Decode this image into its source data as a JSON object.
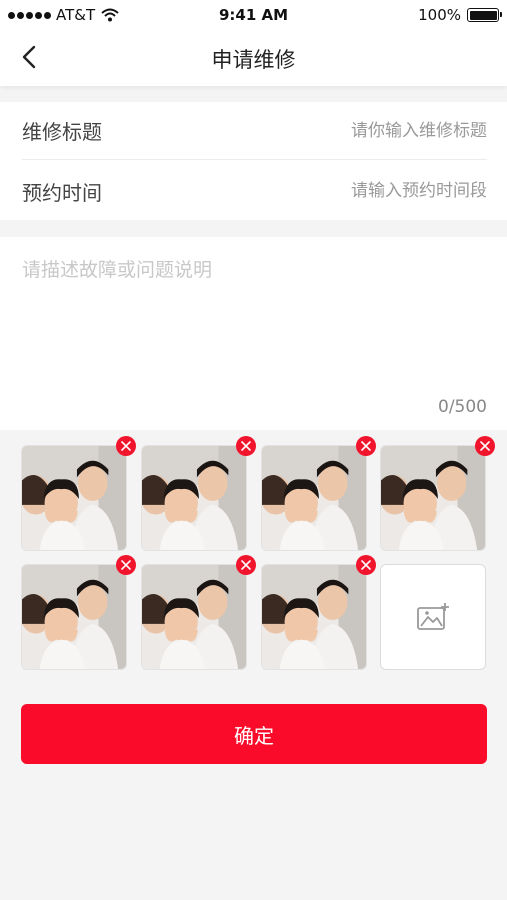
{
  "status_bar": {
    "carrier": "AT&T",
    "time": "9:41 AM",
    "battery": "100%"
  },
  "header": {
    "title": "申请维修"
  },
  "form": {
    "repair_title": {
      "label": "维修标题",
      "placeholder": "请你输入维修标题"
    },
    "appointment_time": {
      "label": "预约时间",
      "placeholder": "请输入预约时间段"
    }
  },
  "description": {
    "placeholder": "请描述故障或问题说明",
    "counter": "0/500"
  },
  "photos": {
    "count": 7,
    "items": [
      "photo-1",
      "photo-2",
      "photo-3",
      "photo-4",
      "photo-5",
      "photo-6",
      "photo-7"
    ]
  },
  "confirm_button": {
    "label": "确定"
  },
  "colors": {
    "accent": "#fb0b2a",
    "remove_badge": "#f0152c",
    "background": "#f4f4f4"
  }
}
